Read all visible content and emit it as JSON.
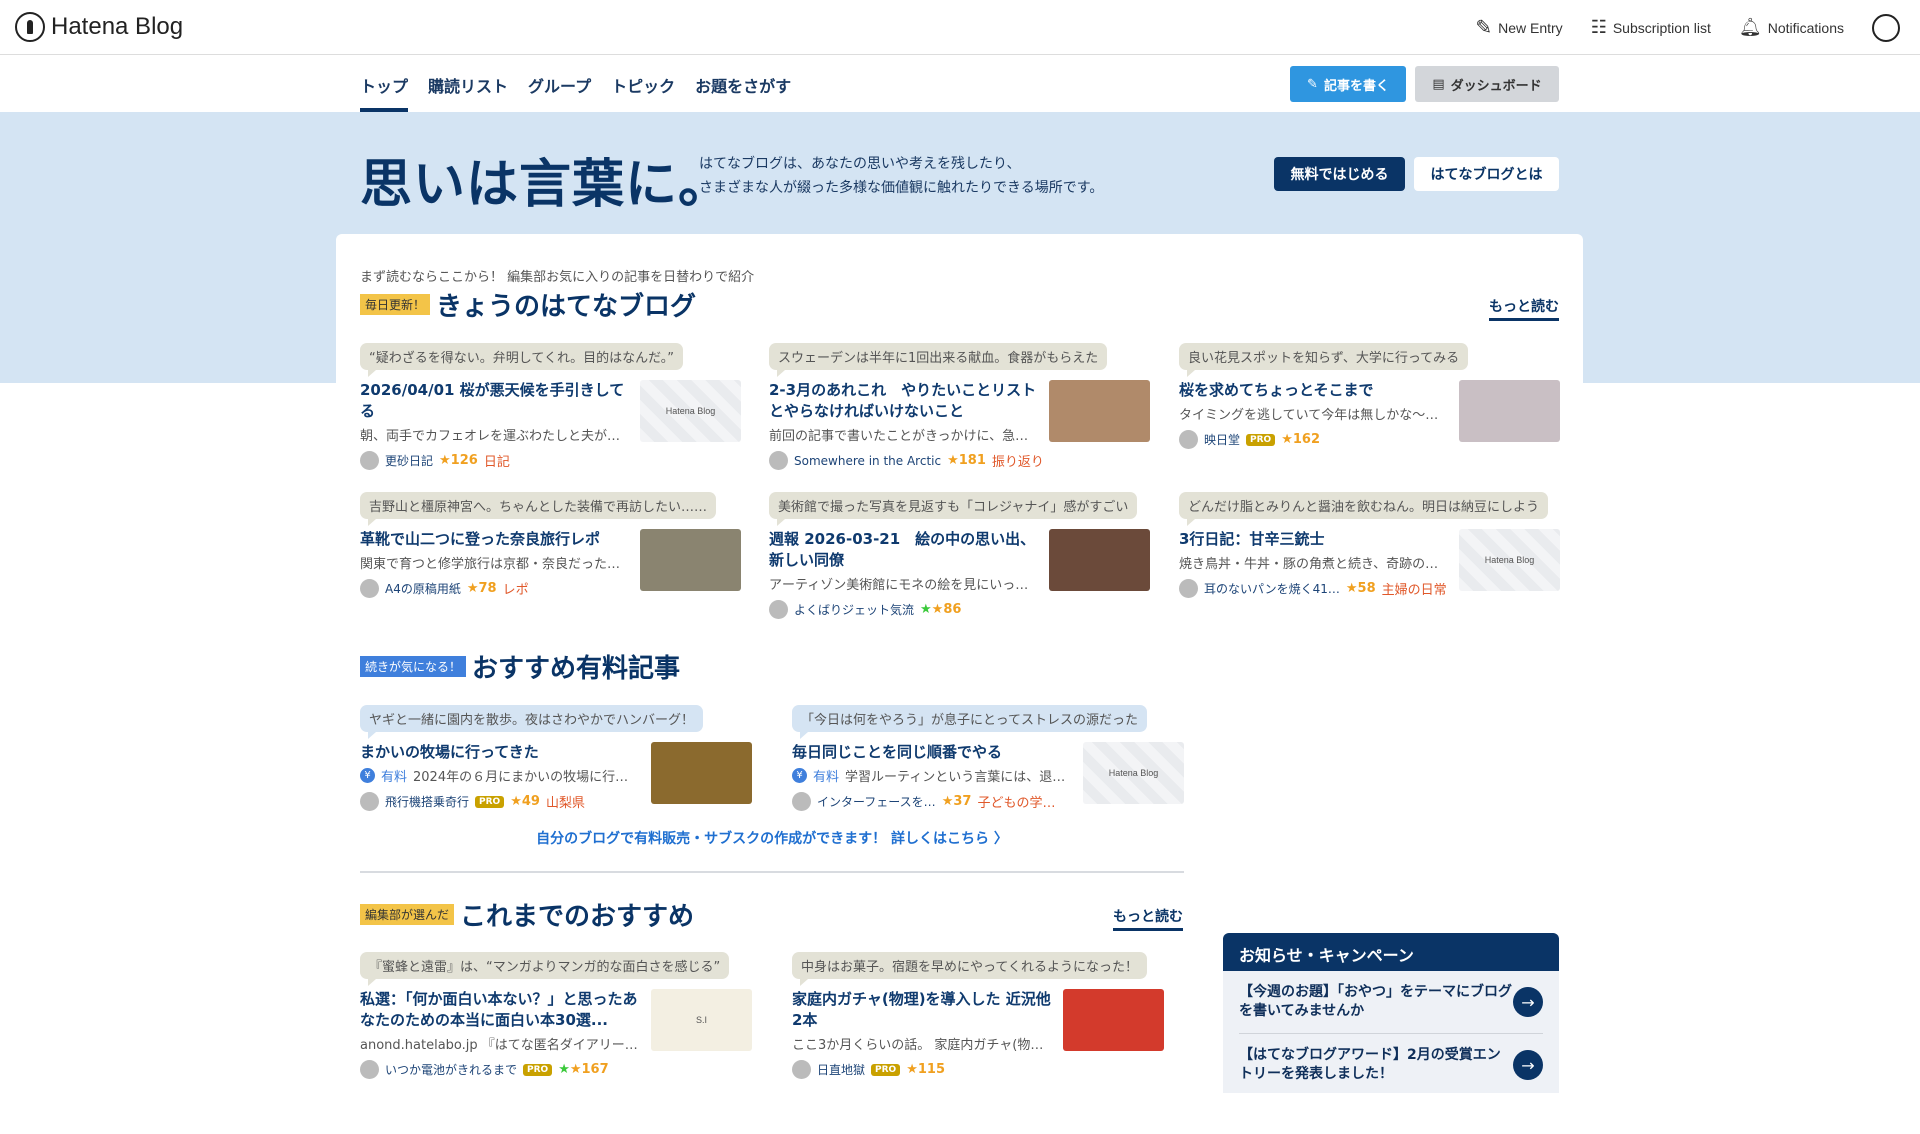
{
  "header": {
    "logo": "Hatena Blog",
    "new_entry": "New Entry",
    "subscription": "Subscription list",
    "notifications": "Notifications"
  },
  "nav": {
    "tabs": [
      "トップ",
      "購読リスト",
      "グループ",
      "トピック",
      "お題をさがす"
    ],
    "write": "記事を書く",
    "dashboard": "ダッシュボード"
  },
  "hero": {
    "title": "思いは言葉に。",
    "desc1": "はてなブログは、あなたの思いや考えを残したり、",
    "desc2": "さまざまな人が綴った多様な価値観に触れたりできる場所です。",
    "start": "無料ではじめる",
    "about": "はてなブログとは"
  },
  "today": {
    "lead": "まず読むならここから！ 編集部お気に入りの記事を日替わりで紹介",
    "badge": "毎日更新！",
    "title": "きょうのはてなブログ",
    "more": "もっと読む",
    "entries": [
      {
        "bubble": "“疑わざるを得ない。弁明してくれ。目的はなんだ。”",
        "title": "2026/04/01 桜が悪天候を手引きしてる",
        "desc": "朝、両手でカフェオレを運ぶわたしと夫が…",
        "blog": "更砂日記",
        "stars": "★126",
        "tag": "日記",
        "thumb": "placeholder",
        "thumb_text": "Hatena Blog"
      },
      {
        "bubble": "スウェーデンは半年に1回出来る献血。食器がもらえた",
        "title": "2-3月のあれこれ　やりたいことリストとやらなければいけないこと",
        "desc": "前回の記事で書いたことがきっかけに、急…",
        "blog": "Somewhere in the Arctic",
        "stars": "★181",
        "tag": "振り返り",
        "thumb": "#b08a6a"
      },
      {
        "bubble": "良い花見スポットを知らず、大学に行ってみる",
        "title": "桜を求めてちょっとそこまで",
        "desc": "タイミングを逃していて今年は無しかな〜…",
        "blog": "映日堂",
        "pro": "PRO",
        "stars": "★162",
        "thumb": "#c9bfc4"
      },
      {
        "bubble": "吉野山と橿原神宮へ。ちゃんとした装備で再訪したい……",
        "title": "革靴で山二つに登った奈良旅行レポ",
        "desc": "関東で育つと修学旅行は京都・奈良だった…",
        "blog": "A4の原稿用紙",
        "stars": "★78",
        "tag": "レポ",
        "thumb": "#8a8470"
      },
      {
        "bubble": "美術館で撮った写真を見返すも「コレジャナイ」感がすごい",
        "title": "週報 2026-03-21　絵の中の思い出、新しい同僚",
        "desc": "アーティゾン美術館にモネの絵を見にいっ…",
        "blog": "よくばりジェット気流",
        "green_star": "★",
        "stars": "★86",
        "thumb": "#6b4a3a"
      },
      {
        "bubble": "どんだけ脂とみりんと醤油を飲むねん。明日は納豆にしよう",
        "title": "3行日記：甘辛三銃士",
        "desc": "焼き鳥丼・牛丼・豚の角煮と続き、奇跡の…",
        "blog": "耳のないパンを焼く41…",
        "stars": "★58",
        "tag": "主婦の日常",
        "thumb": "placeholder",
        "thumb_text": "Hatena Blog"
      }
    ]
  },
  "paid": {
    "badge": "続きが気になる！",
    "title": "おすすめ有料記事",
    "paid_label": "有料",
    "yen": "¥",
    "entries": [
      {
        "bubble": "ヤギと一緒に園内を散歩。夜はさわやかでハンバーグ！",
        "title": "まかいの牧場に行ってきた",
        "desc": "2024年の６月にまかいの牧場に行っ…",
        "blog": "飛行機搭乗奇行",
        "pro": "PRO",
        "stars": "★49",
        "tag": "山梨県",
        "thumb": "#8b6a2e"
      },
      {
        "bubble": "「今日は何をやろう」が息子にとってストレスの源だった",
        "title": "毎日同じことを同じ順番でやる",
        "desc": "学習ルーティンという言葉には、退…",
        "blog": "インターフェースを…",
        "stars": "★37",
        "tag": "子どもの学…",
        "thumb": "placeholder",
        "thumb_text": "Hatena Blog"
      }
    ],
    "link": "自分のブログで有料販売・サブスクの作成ができます！ 詳しくはこちら 〉"
  },
  "past": {
    "badge": "編集部が選んだ",
    "title": "これまでのおすすめ",
    "more": "もっと読む",
    "entries": [
      {
        "bubble": "『蜜蜂と遠雷』は、“マンガよりマンガ的な面白さを感じる”",
        "title": "私選：「何か面白い本ない？」と思ったあなたのための本当に面白い本30選...",
        "desc": "anond.hatelabo.jp 『はてな匿名ダイアリー』…",
        "blog": "いつか電池がきれるまで",
        "pro": "PRO",
        "green_star": "★",
        "stars": "★167",
        "thumb": "#f3efe2",
        "thumb_text": "S.I"
      },
      {
        "bubble": "中身はお菓子。宿題を早めにやってくれるようになった！",
        "title": "家庭内ガチャ(物理)を導入した 近況他2本",
        "desc": "ここ3か月くらいの話。 家庭内ガチャ(物理)を…",
        "blog": "日直地獄",
        "pro": "PRO",
        "stars": "★115",
        "thumb": "#d33a2c"
      }
    ]
  },
  "sidebar": {
    "title": "お知らせ・キャンペーン",
    "items": [
      "【今週のお題】「おやつ」をテーマにブログを書いてみませんか",
      "【はてなブログアワード】2月の受賞エントリーを発表しました！"
    ],
    "arrow": "→"
  }
}
